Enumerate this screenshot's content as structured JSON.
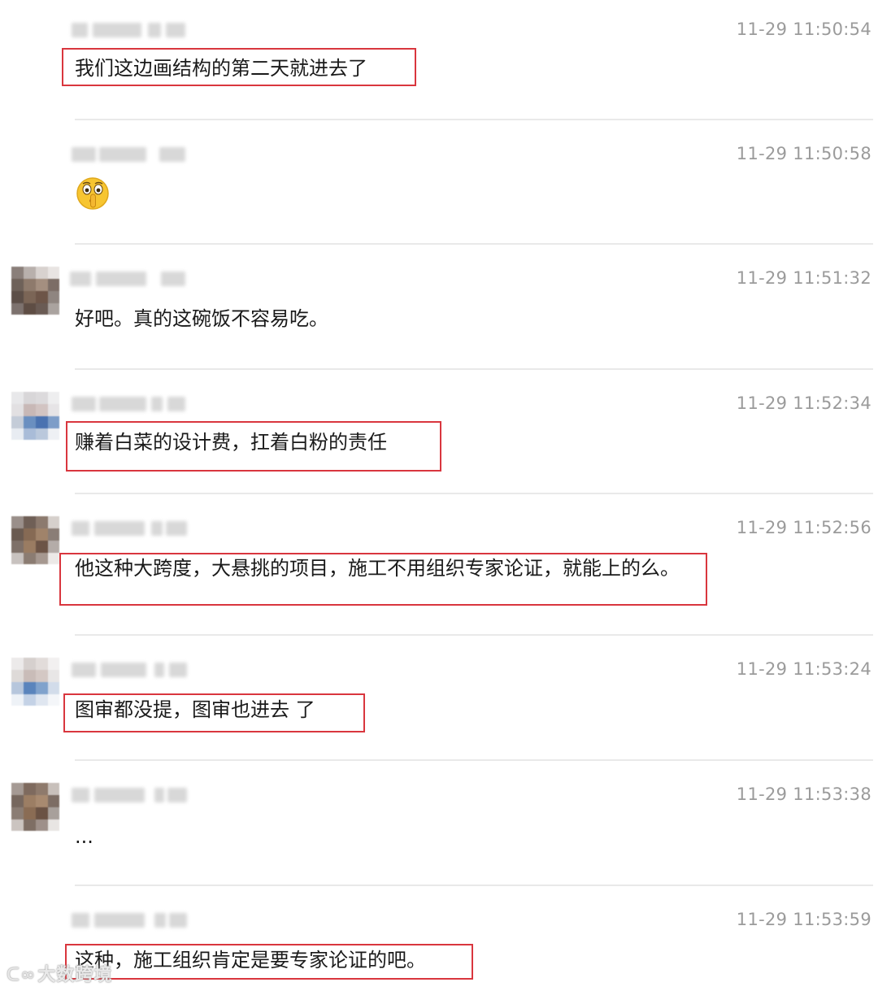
{
  "comments": [
    {
      "time": "11-29 11:50:54",
      "text": "我们这边画结构的第二天就进去了",
      "highlighted": true,
      "has_avatar": false
    },
    {
      "time": "11-29 11:50:58",
      "text": "",
      "emoji": "shush-face-emoji",
      "highlighted": false,
      "has_avatar": false
    },
    {
      "time": "11-29 11:51:32",
      "text": "好吧。真的这碗饭不容易吃。",
      "highlighted": false,
      "has_avatar": true
    },
    {
      "time": "11-29 11:52:34",
      "text": "赚着白菜的设计费，扛着白粉的责任",
      "highlighted": true,
      "has_avatar": true
    },
    {
      "time": "11-29 11:52:56",
      "text": "他这种大跨度，大悬挑的项目，施工不用组织专家论证，就能上的么。",
      "highlighted": true,
      "has_avatar": true
    },
    {
      "time": "11-29 11:53:24",
      "text": "图审都没提，图审也进去 了",
      "highlighted": true,
      "has_avatar": true
    },
    {
      "time": "11-29 11:53:38",
      "text": "...",
      "highlighted": false,
      "has_avatar": true
    },
    {
      "time": "11-29 11:53:59",
      "text": "这种，施工组织肯定是要专家论证的吧。",
      "highlighted": true,
      "has_avatar": false
    }
  ],
  "watermark": {
    "logo": "ᑕ∞",
    "text": "大数跨境"
  },
  "colors": {
    "highlight_border": "#d9363e",
    "timestamp": "#9b9b9b",
    "divider": "#e9e9e9",
    "text": "#1a1a1a"
  }
}
